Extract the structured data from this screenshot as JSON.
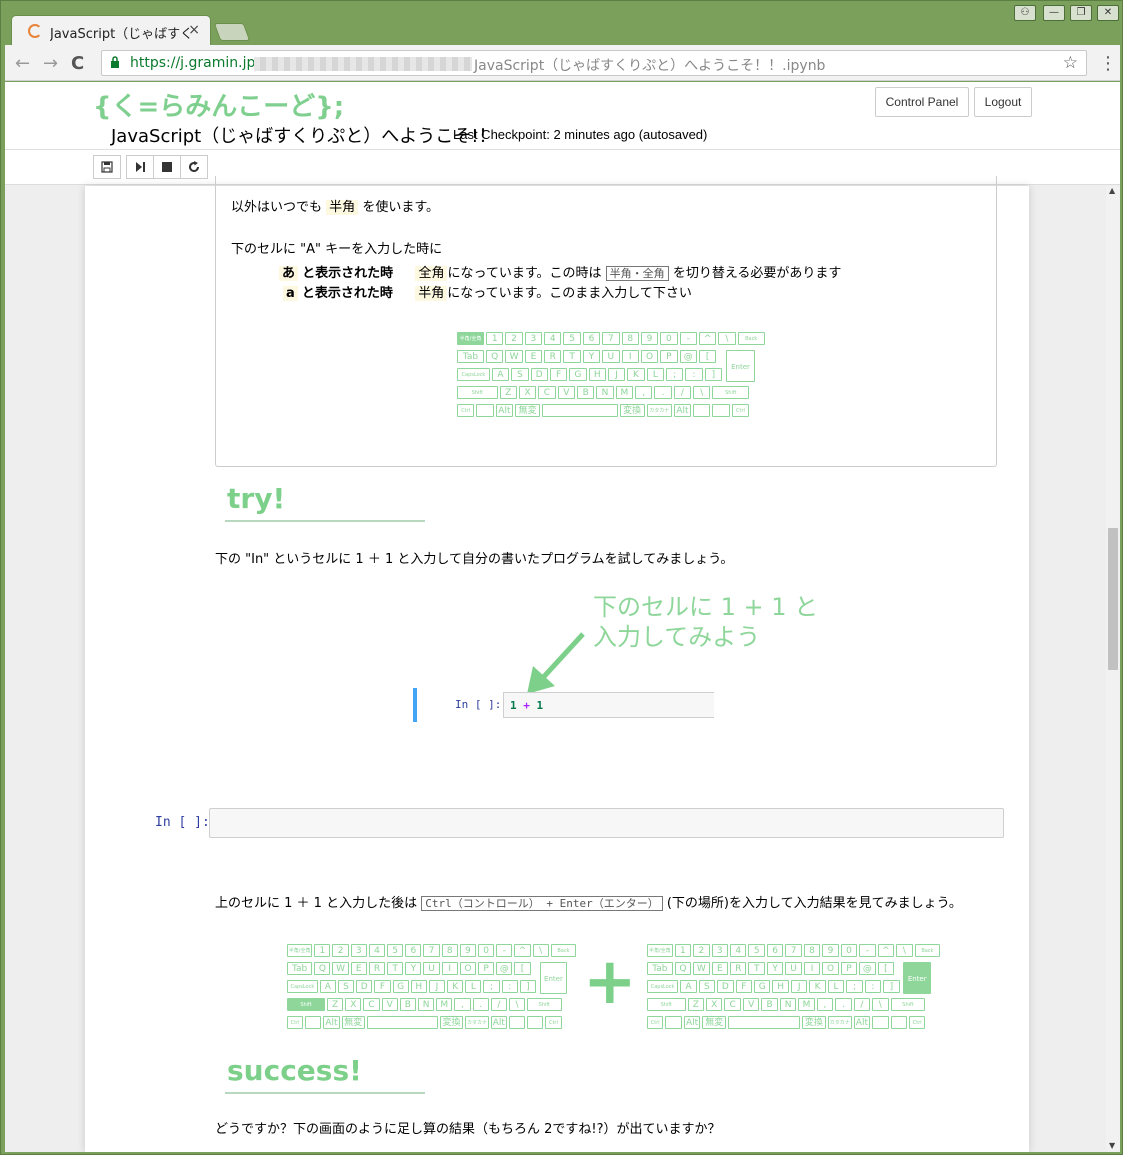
{
  "browser": {
    "tab_title": "JavaScript（じゃばすく",
    "tab_close": "×",
    "url_host": "https://j.gramin.jp",
    "url_rest": "JavaScript（じゃばすくりぷと）へようこそ！！.ipynb",
    "back": "←",
    "forward": "→",
    "reload": "C",
    "star": "☆",
    "menu": "⋮",
    "window_controls": [
      "⚇",
      "—",
      "❐",
      "✕"
    ]
  },
  "header": {
    "logo": "{く=らみんこーど};",
    "title": "JavaScript（じゃばすくりぷと）へようこそ!！",
    "checkpoint": "Last Checkpoint: 2 minutes ago (autosaved)",
    "control_panel": "Control Panel",
    "logout": "Logout"
  },
  "toolbar": {
    "save": "💾",
    "run": "▶|",
    "stop": "■",
    "restart": "↻"
  },
  "section1": {
    "line1_pre": "以外はいつでも",
    "line1_hl": "半角",
    "line1_post": "を使います。",
    "line2": "下のセルに \"A\" キーを入力した時に",
    "row1_key": "あ",
    "row1_label": "と表示された時",
    "row1_hl": "全角",
    "row1_mid": "になっています。この時は",
    "row1_kbd": "半角・全角",
    "row1_post": "を切り替える必要があります",
    "row2_key": "a",
    "row2_label": "と表示された時",
    "row2_hl": "半角",
    "row2_post": "になっています。このまま入力して下さい"
  },
  "try": {
    "heading": "try!",
    "text": "下の \"In\" というセルに 1 ＋ 1 と入力して自分の書いたプログラムを試してみましょう。",
    "callout_line1": "下のセルに 1 + 1 と",
    "callout_line2": "入力してみよう",
    "mini_prompt": "In [ ]:",
    "mini_code_a": "1",
    "mini_code_op": "+",
    "mini_code_b": "1"
  },
  "cell": {
    "prompt": "In [ ]:"
  },
  "run_instr": {
    "pre": "上のセルに 1 ＋ 1 と入力した後は",
    "kbd": "Ctrl（コントロール） + Enter（エンター）",
    "post": "(下の場所)を入力して入力結果を見てみましょう。",
    "plus": "+"
  },
  "success": {
    "heading": "success!",
    "text": "どうですか？下の画面のように足し算の結果（もちろん 2ですね!?）が出ていますか？"
  },
  "keyboard": {
    "row0": [
      "半角/全角",
      "1",
      "2",
      "3",
      "4",
      "5",
      "6",
      "7",
      "8",
      "9",
      "0",
      "-",
      "^",
      "\\",
      "Back space"
    ],
    "row1": [
      "Tab",
      "Q",
      "W",
      "E",
      "R",
      "T",
      "Y",
      "U",
      "I",
      "O",
      "P",
      "@",
      "["
    ],
    "row2": [
      "CapsLock",
      "A",
      "S",
      "D",
      "F",
      "G",
      "H",
      "J",
      "K",
      "L",
      ";",
      ":",
      "]"
    ],
    "row3": [
      "Shift",
      "Z",
      "X",
      "C",
      "V",
      "B",
      "N",
      "M",
      ",",
      ".",
      "/",
      "\\",
      "Shift"
    ],
    "row4": [
      "Ctrl",
      "",
      "Alt",
      "無変換",
      "",
      "変換",
      "カタカナ ひらがな",
      "Alt",
      "",
      "",
      "Ctrl"
    ],
    "enter": "Enter"
  },
  "colors": {
    "accent_green": "#8ed69a",
    "prompt_blue": "#303f9f",
    "selected_cell_bar": "#42a5f5"
  }
}
